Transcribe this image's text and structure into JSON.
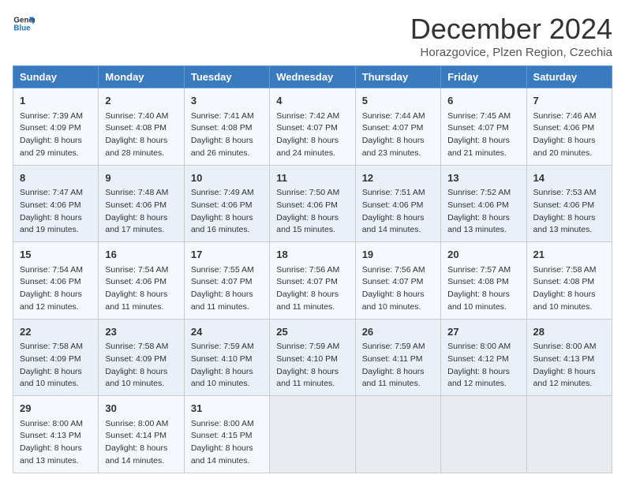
{
  "header": {
    "logo_line1": "General",
    "logo_line2": "Blue",
    "month_title": "December 2024",
    "subtitle": "Horazgovice, Plzen Region, Czechia"
  },
  "weekdays": [
    "Sunday",
    "Monday",
    "Tuesday",
    "Wednesday",
    "Thursday",
    "Friday",
    "Saturday"
  ],
  "weeks": [
    [
      {
        "day": "1",
        "sunrise": "7:39 AM",
        "sunset": "4:09 PM",
        "daylight": "8 hours and 29 minutes."
      },
      {
        "day": "2",
        "sunrise": "7:40 AM",
        "sunset": "4:08 PM",
        "daylight": "8 hours and 28 minutes."
      },
      {
        "day": "3",
        "sunrise": "7:41 AM",
        "sunset": "4:08 PM",
        "daylight": "8 hours and 26 minutes."
      },
      {
        "day": "4",
        "sunrise": "7:42 AM",
        "sunset": "4:07 PM",
        "daylight": "8 hours and 24 minutes."
      },
      {
        "day": "5",
        "sunrise": "7:44 AM",
        "sunset": "4:07 PM",
        "daylight": "8 hours and 23 minutes."
      },
      {
        "day": "6",
        "sunrise": "7:45 AM",
        "sunset": "4:07 PM",
        "daylight": "8 hours and 21 minutes."
      },
      {
        "day": "7",
        "sunrise": "7:46 AM",
        "sunset": "4:06 PM",
        "daylight": "8 hours and 20 minutes."
      }
    ],
    [
      {
        "day": "8",
        "sunrise": "7:47 AM",
        "sunset": "4:06 PM",
        "daylight": "8 hours and 19 minutes."
      },
      {
        "day": "9",
        "sunrise": "7:48 AM",
        "sunset": "4:06 PM",
        "daylight": "8 hours and 17 minutes."
      },
      {
        "day": "10",
        "sunrise": "7:49 AM",
        "sunset": "4:06 PM",
        "daylight": "8 hours and 16 minutes."
      },
      {
        "day": "11",
        "sunrise": "7:50 AM",
        "sunset": "4:06 PM",
        "daylight": "8 hours and 15 minutes."
      },
      {
        "day": "12",
        "sunrise": "7:51 AM",
        "sunset": "4:06 PM",
        "daylight": "8 hours and 14 minutes."
      },
      {
        "day": "13",
        "sunrise": "7:52 AM",
        "sunset": "4:06 PM",
        "daylight": "8 hours and 13 minutes."
      },
      {
        "day": "14",
        "sunrise": "7:53 AM",
        "sunset": "4:06 PM",
        "daylight": "8 hours and 13 minutes."
      }
    ],
    [
      {
        "day": "15",
        "sunrise": "7:54 AM",
        "sunset": "4:06 PM",
        "daylight": "8 hours and 12 minutes."
      },
      {
        "day": "16",
        "sunrise": "7:54 AM",
        "sunset": "4:06 PM",
        "daylight": "8 hours and 11 minutes."
      },
      {
        "day": "17",
        "sunrise": "7:55 AM",
        "sunset": "4:07 PM",
        "daylight": "8 hours and 11 minutes."
      },
      {
        "day": "18",
        "sunrise": "7:56 AM",
        "sunset": "4:07 PM",
        "daylight": "8 hours and 11 minutes."
      },
      {
        "day": "19",
        "sunrise": "7:56 AM",
        "sunset": "4:07 PM",
        "daylight": "8 hours and 10 minutes."
      },
      {
        "day": "20",
        "sunrise": "7:57 AM",
        "sunset": "4:08 PM",
        "daylight": "8 hours and 10 minutes."
      },
      {
        "day": "21",
        "sunrise": "7:58 AM",
        "sunset": "4:08 PM",
        "daylight": "8 hours and 10 minutes."
      }
    ],
    [
      {
        "day": "22",
        "sunrise": "7:58 AM",
        "sunset": "4:09 PM",
        "daylight": "8 hours and 10 minutes."
      },
      {
        "day": "23",
        "sunrise": "7:58 AM",
        "sunset": "4:09 PM",
        "daylight": "8 hours and 10 minutes."
      },
      {
        "day": "24",
        "sunrise": "7:59 AM",
        "sunset": "4:10 PM",
        "daylight": "8 hours and 10 minutes."
      },
      {
        "day": "25",
        "sunrise": "7:59 AM",
        "sunset": "4:10 PM",
        "daylight": "8 hours and 11 minutes."
      },
      {
        "day": "26",
        "sunrise": "7:59 AM",
        "sunset": "4:11 PM",
        "daylight": "8 hours and 11 minutes."
      },
      {
        "day": "27",
        "sunrise": "8:00 AM",
        "sunset": "4:12 PM",
        "daylight": "8 hours and 12 minutes."
      },
      {
        "day": "28",
        "sunrise": "8:00 AM",
        "sunset": "4:13 PM",
        "daylight": "8 hours and 12 minutes."
      }
    ],
    [
      {
        "day": "29",
        "sunrise": "8:00 AM",
        "sunset": "4:13 PM",
        "daylight": "8 hours and 13 minutes."
      },
      {
        "day": "30",
        "sunrise": "8:00 AM",
        "sunset": "4:14 PM",
        "daylight": "8 hours and 14 minutes."
      },
      {
        "day": "31",
        "sunrise": "8:00 AM",
        "sunset": "4:15 PM",
        "daylight": "8 hours and 14 minutes."
      },
      null,
      null,
      null,
      null
    ]
  ],
  "labels": {
    "sunrise": "Sunrise:",
    "sunset": "Sunset:",
    "daylight": "Daylight:"
  }
}
